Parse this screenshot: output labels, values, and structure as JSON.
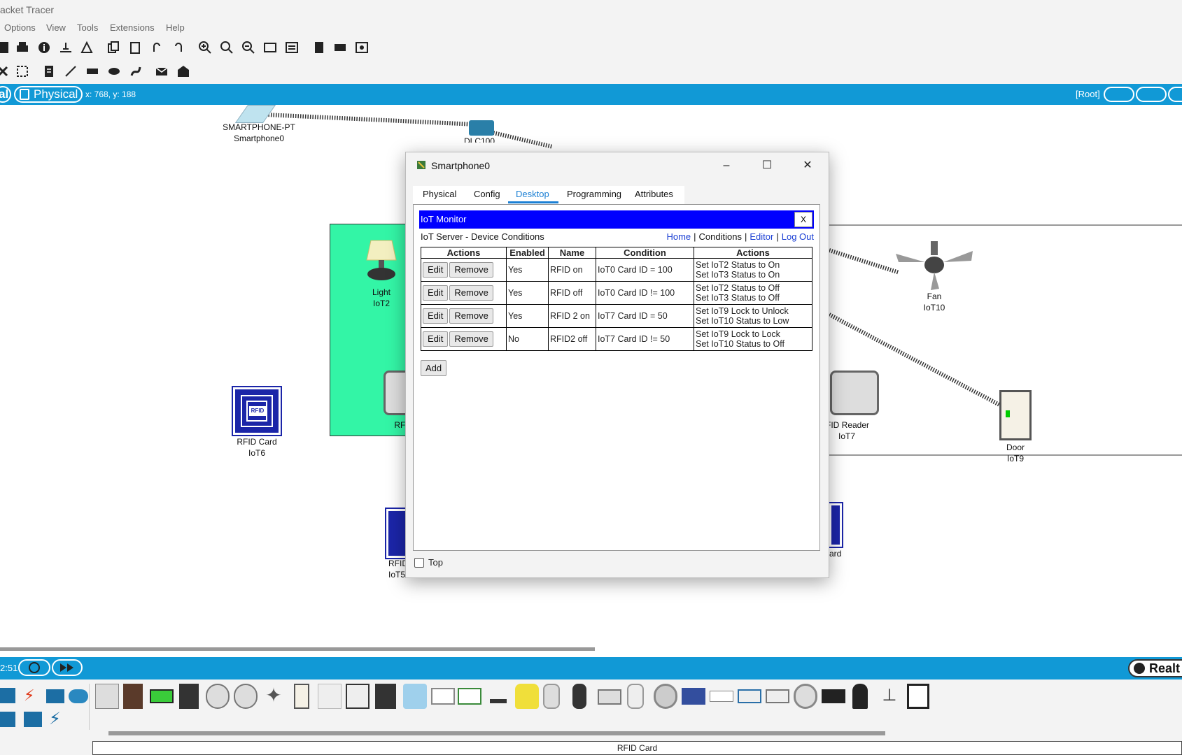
{
  "app": {
    "title": "acket Tracer"
  },
  "menu": [
    "Options",
    "View",
    "Tools",
    "Extensions",
    "Help"
  ],
  "workspace": {
    "logical_label": "al",
    "physical_label": "Physical",
    "coords": "x: 768, y: 188",
    "root_label": "[Root]"
  },
  "devices": [
    {
      "id": "smartphone",
      "line1": "SMARTPHONE-PT",
      "line2": "Smartphone0"
    },
    {
      "id": "mcu",
      "line1": "DLC100",
      "line2": ""
    },
    {
      "id": "light",
      "line1": "Light",
      "line2": "IoT2"
    },
    {
      "id": "rfid-card-6",
      "line1": "RFID Card",
      "line2": "IoT6"
    },
    {
      "id": "rfid-partial",
      "line1": "RFI",
      "line2": ""
    },
    {
      "id": "fan",
      "line1": "Fan",
      "line2": "IoT10"
    },
    {
      "id": "rfid-reader",
      "line1": "FID Reader",
      "line2": "IoT7"
    },
    {
      "id": "door",
      "line1": "Door",
      "line2": "IoT9"
    },
    {
      "id": "rfid-bottom",
      "line1": "RFID",
      "line2": "IoT5"
    },
    {
      "id": "card-right",
      "line1": "ard",
      "line2": ""
    }
  ],
  "dialog": {
    "title": "Smartphone0",
    "tabs": [
      "Physical",
      "Config",
      "Desktop",
      "Programming",
      "Attributes"
    ],
    "active_tab": "Desktop",
    "app_header": "IoT Monitor",
    "close_label": "X",
    "subtitle": "IoT Server - Device Conditions",
    "nav": {
      "home": "Home",
      "conditions": "Conditions",
      "editor": "Editor",
      "logout": "Log Out"
    },
    "table_headers": [
      "Actions",
      "Enabled",
      "Name",
      "Condition",
      "Actions"
    ],
    "edit_label": "Edit",
    "remove_label": "Remove",
    "rows": [
      {
        "enabled": "Yes",
        "name": "RFID on",
        "condition": "IoT0 Card ID = 100",
        "action1": "Set IoT2 Status to On",
        "action2": "Set IoT3 Status to On"
      },
      {
        "enabled": "Yes",
        "name": "RFID off",
        "condition": "IoT0 Card ID != 100",
        "action1": "Set IoT2 Status to Off",
        "action2": "Set IoT3 Status to Off"
      },
      {
        "enabled": "Yes",
        "name": "RFID 2 on",
        "condition": "IoT7 Card ID = 50",
        "action1": "Set IoT9 Lock to Unlock",
        "action2": "Set IoT10 Status to Low"
      },
      {
        "enabled": "No",
        "name": "RFID2 off",
        "condition": "IoT7 Card ID != 50",
        "action1": "Set IoT9 Lock to Lock",
        "action2": "Set IoT10 Status to Off"
      }
    ],
    "add_label": "Add",
    "top_label": "Top"
  },
  "bottom": {
    "time": "2:51",
    "realtime": "Realt",
    "selected_device": "RFID Card"
  }
}
